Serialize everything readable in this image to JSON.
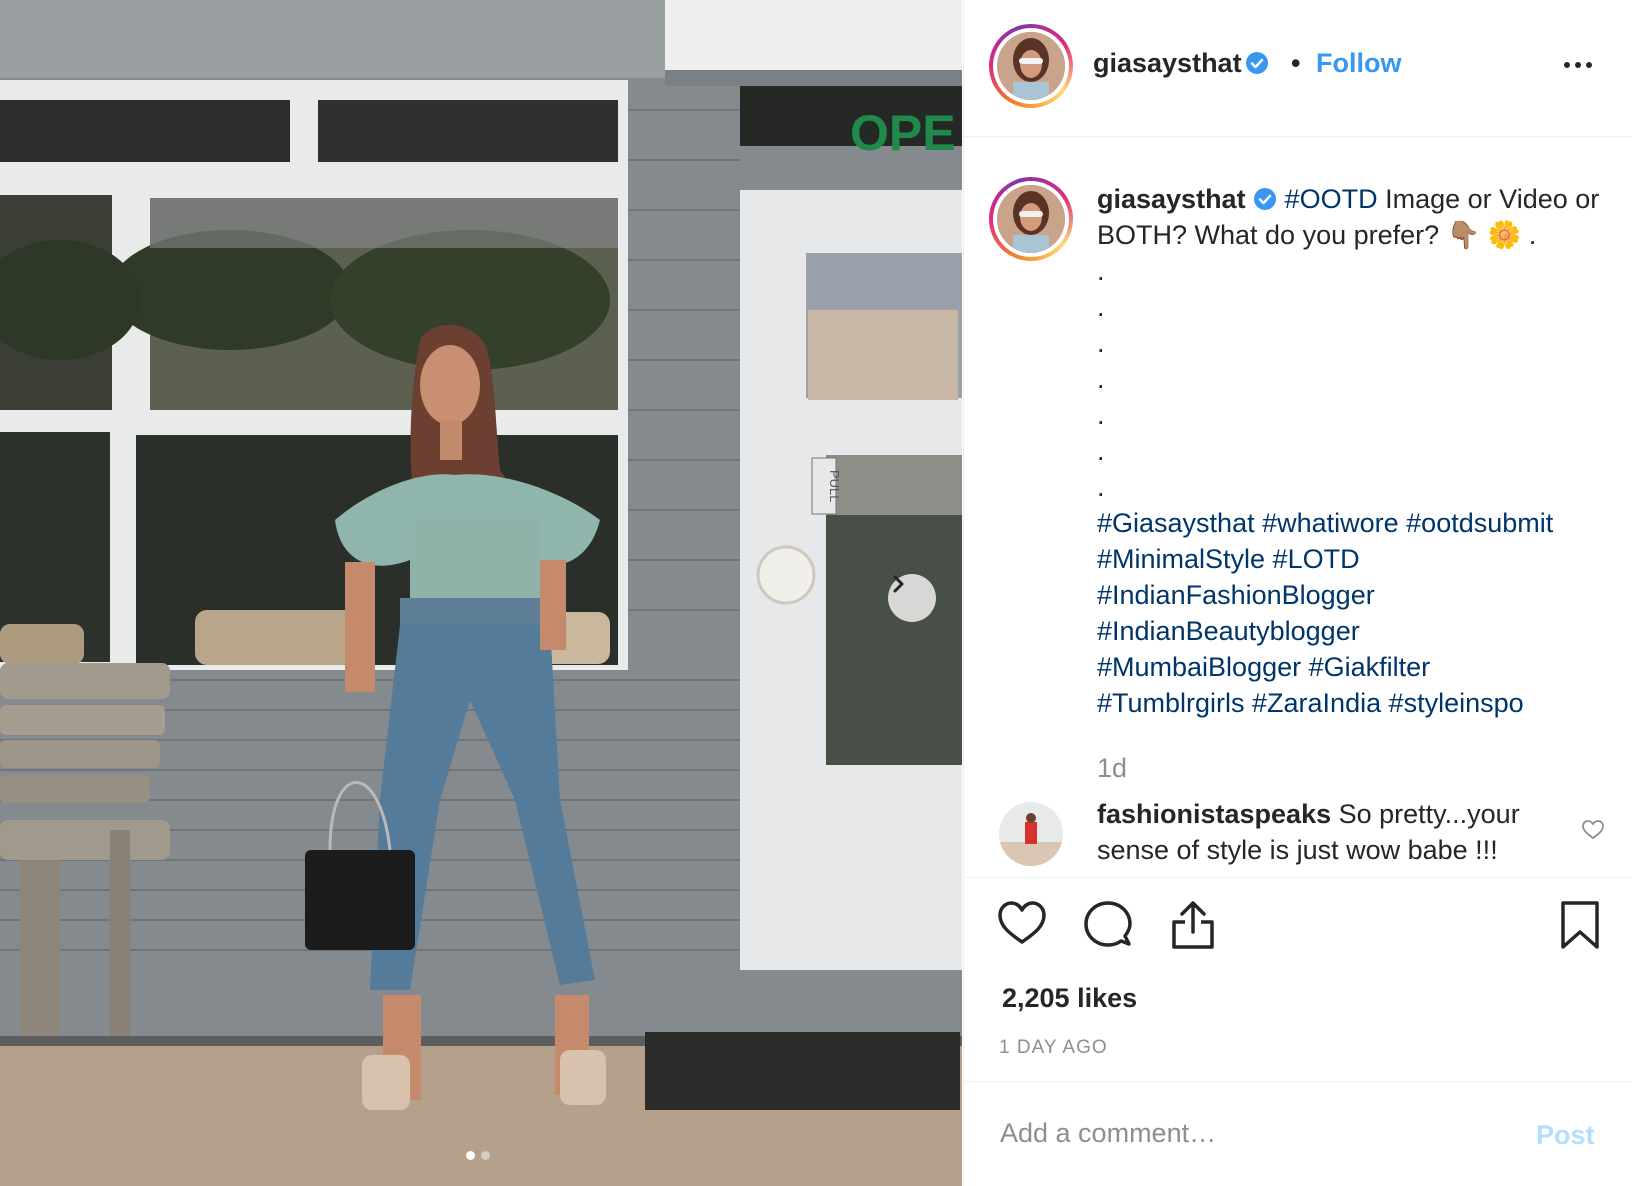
{
  "post": {
    "username": "giasaysthat",
    "follow_label": "Follow",
    "separator": "•",
    "verified_icon": "verified-badge-icon",
    "more_icon": "more-options-icon"
  },
  "caption": {
    "username": "giasaysthat",
    "hashtag_1": "#OOTD",
    "text_1": " Image or Video or BOTH? What do you prefer? 👇🏽 🌼 .",
    "dots": [
      ".",
      ".",
      ".",
      ".",
      ".",
      ".",
      "."
    ],
    "hashtags": [
      "#Giasaysthat #whatiwore #ootdsubmit",
      "#MinimalStyle #LOTD",
      "#IndianFashionBlogger",
      "#IndianBeautyblogger",
      "#MumbaiBlogger #Giakfilter",
      "#Tumblrgirls #ZaraIndia #styleinspo"
    ],
    "age": "1d"
  },
  "comment": {
    "username": "fashionistaspeaks",
    "text": " So pretty...your sense of style is just wow babe !!!"
  },
  "actions": {
    "like_icon": "heart-icon",
    "comment_icon": "comment-icon",
    "share_icon": "share-icon",
    "save_icon": "bookmark-icon"
  },
  "likes_text": "2,205 likes",
  "posted_ago": "1 DAY AGO",
  "add_comment": {
    "placeholder": "Add a comment…",
    "post_label": "Post"
  },
  "photo": {
    "door_sign": "OPE",
    "pull_label": "PULL",
    "carousel_dots": 2,
    "active_dot": 0
  }
}
